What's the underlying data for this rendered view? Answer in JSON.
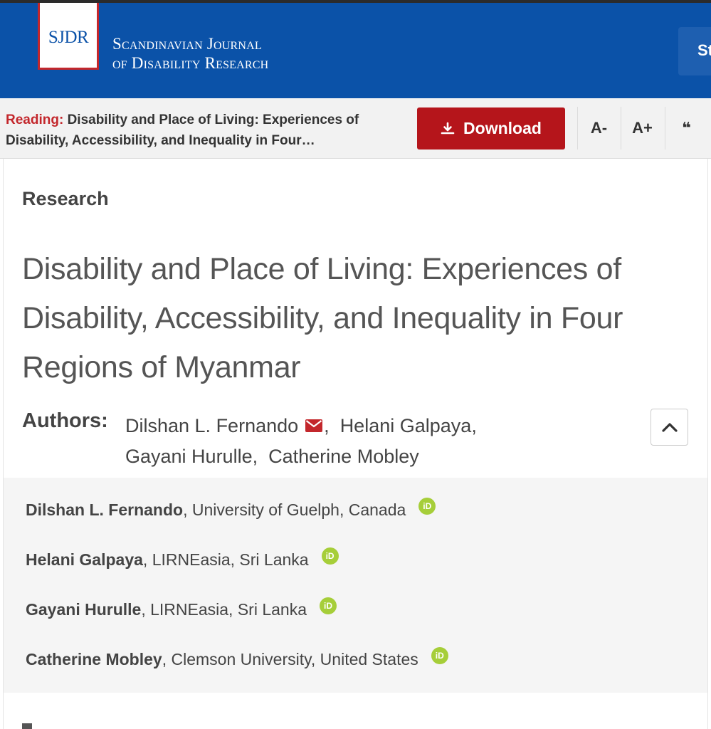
{
  "header": {
    "logo_abbr": "SJDR",
    "journal_line1": "Scandinavian Journal",
    "journal_line2": "of Disability Research",
    "right_button_label": "St",
    "brand_color": "#0b52a8",
    "accent_color": "#c3272c"
  },
  "reading_bar": {
    "label": "Reading:",
    "title": "Disability and Place of Living: Experiences of Disability, Accessibility, and Inequality in Four…",
    "download_label": "Download",
    "download_icon": "download-icon",
    "font_decrease": "A-",
    "font_increase": "A+",
    "cite_icon": "quote-icon",
    "cite_glyph": "❝"
  },
  "article": {
    "section": "Research",
    "title": "Disability and Place of Living: Experiences of Disability, Accessibility, and Inequality in Four Regions of Myanmar",
    "authors_label": "Authors:",
    "authors": [
      {
        "name": "Dilshan L. Fernando",
        "sep": ","
      },
      {
        "name": "Helani Galpaya",
        "sep": ","
      },
      {
        "name": "Gayani Hurulle",
        "sep": ","
      },
      {
        "name": "Catherine Mobley",
        "sep": ""
      }
    ],
    "collapse_icon": "chevron-up-icon"
  },
  "affiliations": [
    {
      "name": "Dilshan L. Fernando",
      "detail": ", University of Guelph, Canada",
      "orcid": "iD"
    },
    {
      "name": "Helani Galpaya",
      "detail": ", LIRNEasia, Sri Lanka",
      "orcid": "iD"
    },
    {
      "name": "Gayani Hurulle",
      "detail": ", LIRNEasia, Sri Lanka",
      "orcid": "iD"
    },
    {
      "name": "Catherine Mobley",
      "detail": ", Clemson University, United States",
      "orcid": "iD"
    }
  ]
}
